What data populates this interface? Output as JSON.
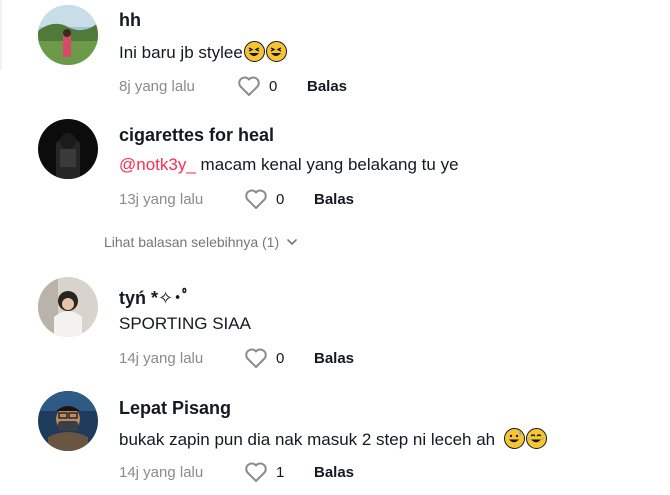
{
  "comments": [
    {
      "username": "hh",
      "text": "Ini baru jb stylee",
      "emojis": [
        "grinning-squinting-face",
        "grinning-squinting-face"
      ],
      "time": "8j yang lalu",
      "likes": "0",
      "reply_label": "Balas"
    },
    {
      "username": "cigarettes for heal",
      "mention": "@notk3y_",
      "text": " macam kenal yang belakang tu ye",
      "time": "13j yang lalu",
      "likes": "0",
      "reply_label": "Balas"
    },
    {
      "username": "tyń *✧･ﾟ",
      "text": "SPORTING SIAA",
      "time": "14j yang lalu",
      "likes": "0",
      "reply_label": "Balas"
    },
    {
      "username": "Lepat Pisang",
      "text": "bukak zapin pun dia nak masuk 2 step ni leceh ah",
      "emojis": [
        "grinning-face-with-sweat",
        "face-with-tears-of-joy"
      ],
      "time": "14j yang lalu",
      "likes": "1",
      "reply_label": "Balas"
    }
  ],
  "view_more_replies": "Lihat balasan selebihnya (1)",
  "colors": {
    "mention": "#fe2c55",
    "meta_text": "#8a8b91",
    "primary_text": "#161823"
  }
}
